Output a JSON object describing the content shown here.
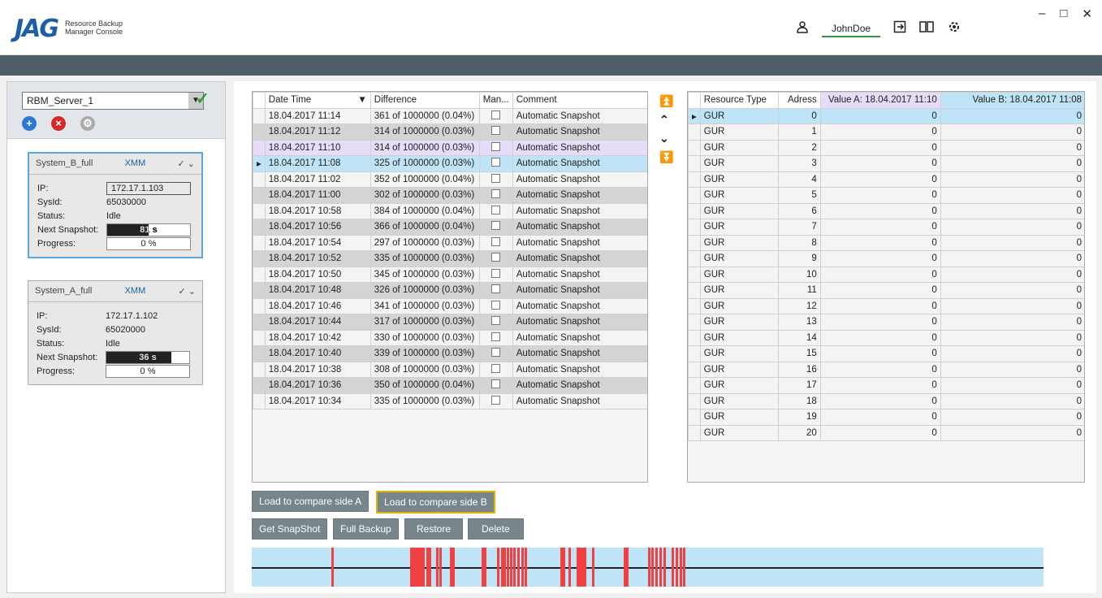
{
  "app": {
    "logo": "JAG",
    "subtitle_line1": "Resource Backup",
    "subtitle_line2": "Manager Console",
    "username": "JohnDoe"
  },
  "window_controls": {
    "minimize": "–",
    "maximize": "□",
    "close": "✕"
  },
  "server": {
    "selected": "RBM_Server_1"
  },
  "cards": [
    {
      "name": "System_B_full",
      "type": "XMM",
      "ip": "172.17.1.103",
      "sysid": "65030000",
      "status": "Idle",
      "next_snapshot": "81 s",
      "next_snapshot_fraction": 0.5,
      "progress": "0 %"
    },
    {
      "name": "System_A_full",
      "type": "XMM",
      "ip": "172.17.1.102",
      "sysid": "65020000",
      "status": "Idle",
      "next_snapshot": "36 s",
      "next_snapshot_fraction": 0.78,
      "progress": "0 %"
    }
  ],
  "card_labels": {
    "ip": "IP:",
    "sysid": "SysId:",
    "status": "Status:",
    "next": "Next Snapshot:",
    "progress": "Progress:"
  },
  "snap_table": {
    "headers": [
      "Date Time",
      "Difference",
      "Man...",
      "Comment"
    ],
    "rows": [
      [
        "18.04.2017 11:14",
        "361 of 1000000 (0.04%)",
        "Automatic Snapshot"
      ],
      [
        "18.04.2017 11:12",
        "314 of 1000000 (0.03%)",
        "Automatic Snapshot"
      ],
      [
        "18.04.2017 11:10",
        "314 of 1000000 (0.03%)",
        "Automatic Snapshot"
      ],
      [
        "18.04.2017 11:08",
        "325 of 1000000 (0.03%)",
        "Automatic Snapshot"
      ],
      [
        "18.04.2017 11:02",
        "352 of 1000000 (0.04%)",
        "Automatic Snapshot"
      ],
      [
        "18.04.2017 11:00",
        "302 of 1000000 (0.03%)",
        "Automatic Snapshot"
      ],
      [
        "18.04.2017 10:58",
        "384 of 1000000 (0.04%)",
        "Automatic Snapshot"
      ],
      [
        "18.04.2017 10:56",
        "366 of 1000000 (0.04%)",
        "Automatic Snapshot"
      ],
      [
        "18.04.2017 10:54",
        "297 of 1000000 (0.03%)",
        "Automatic Snapshot"
      ],
      [
        "18.04.2017 10:52",
        "335 of 1000000 (0.03%)",
        "Automatic Snapshot"
      ],
      [
        "18.04.2017 10:50",
        "345 of 1000000 (0.03%)",
        "Automatic Snapshot"
      ],
      [
        "18.04.2017 10:48",
        "326 of 1000000 (0.03%)",
        "Automatic Snapshot"
      ],
      [
        "18.04.2017 10:46",
        "341 of 1000000 (0.03%)",
        "Automatic Snapshot"
      ],
      [
        "18.04.2017 10:44",
        "317 of 1000000 (0.03%)",
        "Automatic Snapshot"
      ],
      [
        "18.04.2017 10:42",
        "330 of 1000000 (0.03%)",
        "Automatic Snapshot"
      ],
      [
        "18.04.2017 10:40",
        "339 of 1000000 (0.03%)",
        "Automatic Snapshot"
      ],
      [
        "18.04.2017 10:38",
        "308 of 1000000 (0.03%)",
        "Automatic Snapshot"
      ],
      [
        "18.04.2017 10:36",
        "350 of 1000000 (0.04%)",
        "Automatic Snapshot"
      ],
      [
        "18.04.2017 10:34",
        "335 of 1000000 (0.03%)",
        "Automatic Snapshot"
      ]
    ]
  },
  "res_table": {
    "headers": [
      "Resource Type",
      "Adress",
      "Value A: 18.04.2017 11:10",
      "Value B: 18.04.2017 11:08"
    ],
    "rows": [
      [
        "GUR",
        "0",
        "0",
        "0"
      ],
      [
        "GUR",
        "1",
        "0",
        "0"
      ],
      [
        "GUR",
        "2",
        "0",
        "0"
      ],
      [
        "GUR",
        "3",
        "0",
        "0"
      ],
      [
        "GUR",
        "4",
        "0",
        "0"
      ],
      [
        "GUR",
        "5",
        "0",
        "0"
      ],
      [
        "GUR",
        "6",
        "0",
        "0"
      ],
      [
        "GUR",
        "7",
        "0",
        "0"
      ],
      [
        "GUR",
        "8",
        "0",
        "0"
      ],
      [
        "GUR",
        "9",
        "0",
        "0"
      ],
      [
        "GUR",
        "10",
        "0",
        "0"
      ],
      [
        "GUR",
        "11",
        "0",
        "0"
      ],
      [
        "GUR",
        "12",
        "0",
        "0"
      ],
      [
        "GUR",
        "13",
        "0",
        "0"
      ],
      [
        "GUR",
        "14",
        "0",
        "0"
      ],
      [
        "GUR",
        "15",
        "0",
        "0"
      ],
      [
        "GUR",
        "16",
        "0",
        "0"
      ],
      [
        "GUR",
        "17",
        "0",
        "0"
      ],
      [
        "GUR",
        "18",
        "0",
        "0"
      ],
      [
        "GUR",
        "19",
        "0",
        "0"
      ],
      [
        "GUR",
        "20",
        "0",
        "0"
      ]
    ]
  },
  "buttons": {
    "load_a": "Load to compare side A",
    "load_b": "Load to compare side B",
    "get_snapshot": "Get SnapShot",
    "full_backup": "Full Backup",
    "restore": "Restore",
    "delete": "Delete"
  },
  "timeline_marks": [
    0.1,
    0.2,
    0.203,
    0.206,
    0.209,
    0.212,
    0.215,
    0.22,
    0.224,
    0.233,
    0.237,
    0.25,
    0.253,
    0.29,
    0.293,
    0.31,
    0.315,
    0.318,
    0.322,
    0.326,
    0.33,
    0.335,
    0.34,
    0.345,
    0.39,
    0.393,
    0.4,
    0.41,
    0.413,
    0.416,
    0.419,
    0.43,
    0.47,
    0.473,
    0.5,
    0.505,
    0.51,
    0.515,
    0.52,
    0.53,
    0.535,
    0.54,
    0.545
  ]
}
